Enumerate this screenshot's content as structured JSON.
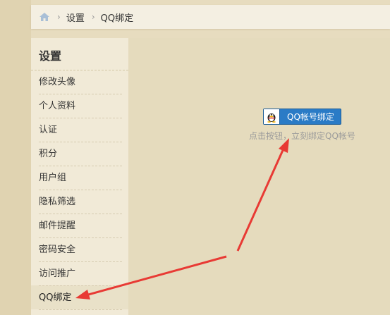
{
  "breadcrumb": {
    "home_icon": "home-icon",
    "items": [
      "设置",
      "QQ绑定"
    ]
  },
  "sidebar": {
    "title": "设置",
    "items": [
      "修改头像",
      "个人资料",
      "认证",
      "积分",
      "用户组",
      "隐私筛选",
      "邮件提醒",
      "密码安全",
      "访问推广",
      "QQ绑定"
    ],
    "active_index": 9
  },
  "bind": {
    "button_icon": "qq-penguin-icon",
    "button_label": "QQ帐号绑定",
    "hint": "点击按钮，立刻绑定QQ帐号"
  },
  "colors": {
    "background": "#e7dcbf",
    "sidebar": "#f1ead7",
    "button": "#2a7bc6",
    "arrow": "#e83a34"
  }
}
